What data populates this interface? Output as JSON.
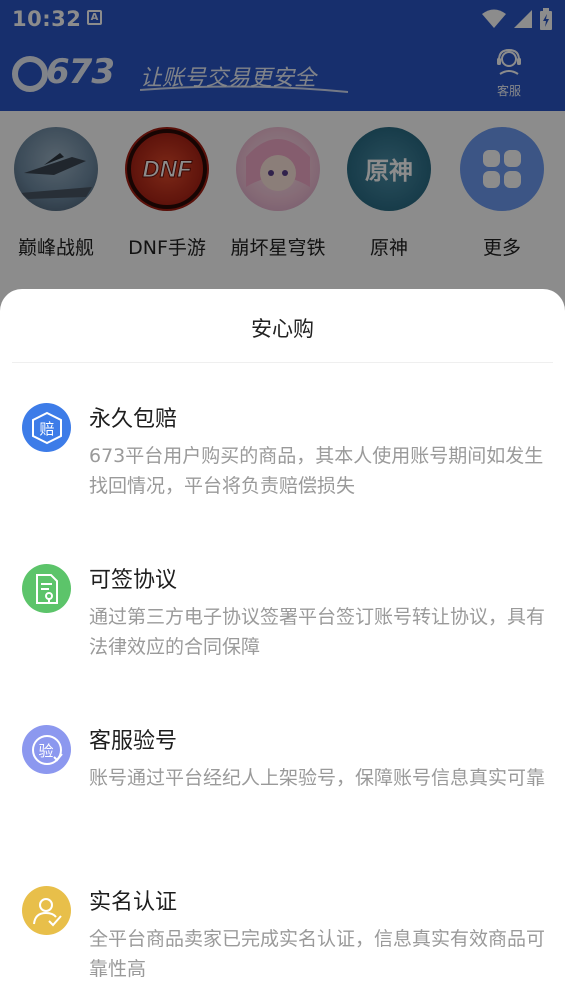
{
  "status_bar": {
    "time": "10:32",
    "notification_badge": "A",
    "icons": [
      "wifi-icon",
      "signal-icon",
      "battery-charging-icon"
    ]
  },
  "header": {
    "logo_number": "673",
    "logo_slogan": "让账号交易更安全",
    "service_label": "客服",
    "background_color": "#2a56c6"
  },
  "games": [
    {
      "label": "巅峰战舰",
      "icon": "warship-icon"
    },
    {
      "label": "DNF手游",
      "icon": "dnf-icon",
      "icon_text": "DNF"
    },
    {
      "label": "崩坏星穹铁",
      "icon": "anime-character-icon"
    },
    {
      "label": "原神",
      "icon": "genshin-icon",
      "icon_text": "原神"
    },
    {
      "label": "更多",
      "icon": "grid-more-icon"
    }
  ],
  "sheet": {
    "title": "安心购",
    "features": [
      {
        "title": "永久包赔",
        "desc": "673平台用户购买的商品，其本人使用账号期间如发生找回情况，平台将负责赔偿损失",
        "icon": "compensation-shield-icon",
        "icon_char": "赔",
        "color": "#3d7ce8"
      },
      {
        "title": "可签协议",
        "desc": "通过第三方电子协议签署平台签订账号转让协议，具有法律效应的合同保障",
        "icon": "contract-document-icon",
        "color": "#5cc46a"
      },
      {
        "title": "客服验号",
        "desc": "账号通过平台经纪人上架验号，保障账号信息真实可靠",
        "icon": "verify-account-icon",
        "icon_char": "验",
        "color": "#8c98ef"
      },
      {
        "title": "实名认证",
        "desc": "全平台商品卖家已完成实名认证，信息真实有效商品可靠性高",
        "icon": "real-name-user-icon",
        "color": "#e8bf4a"
      }
    ]
  }
}
